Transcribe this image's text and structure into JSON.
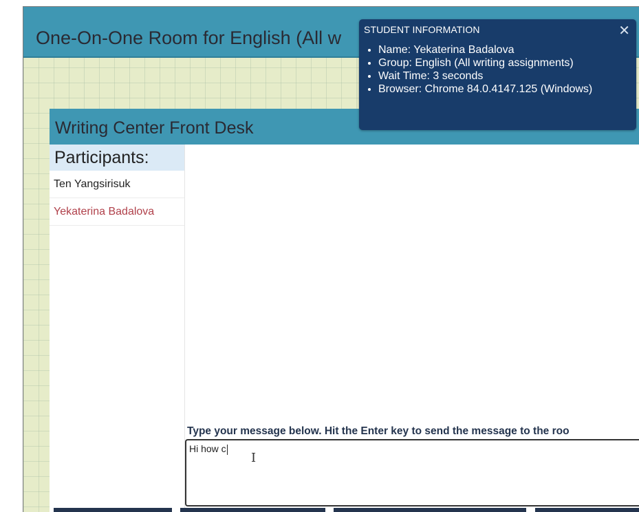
{
  "room": {
    "title": "One-On-One Room for English (All w"
  },
  "panel": {
    "title": "Writing Center Front Desk"
  },
  "participants": {
    "heading": "Participants:",
    "items": [
      {
        "name": "Ten Yangsirisuk",
        "highlighted": false
      },
      {
        "name": "Yekaterina Badalova",
        "highlighted": true
      }
    ]
  },
  "composer": {
    "label": "Type your message below. Hit the Enter key to send the message to the roo",
    "value": "Hi how c"
  },
  "student_info": {
    "title": "STUDENT INFORMATION",
    "close_icon": "close-icon",
    "items": [
      "Name: Yekaterina Badalova",
      "Group: English (All writing assignments)",
      "Wait Time: 3 seconds",
      "Browser: Chrome 84.0.4147.125 (Windows)"
    ]
  },
  "colors": {
    "header_teal": "#3f97b3",
    "popup_navy": "#183c6a",
    "highlighted_participant": "#b0404a",
    "grid_background": "#e6ecc9"
  }
}
